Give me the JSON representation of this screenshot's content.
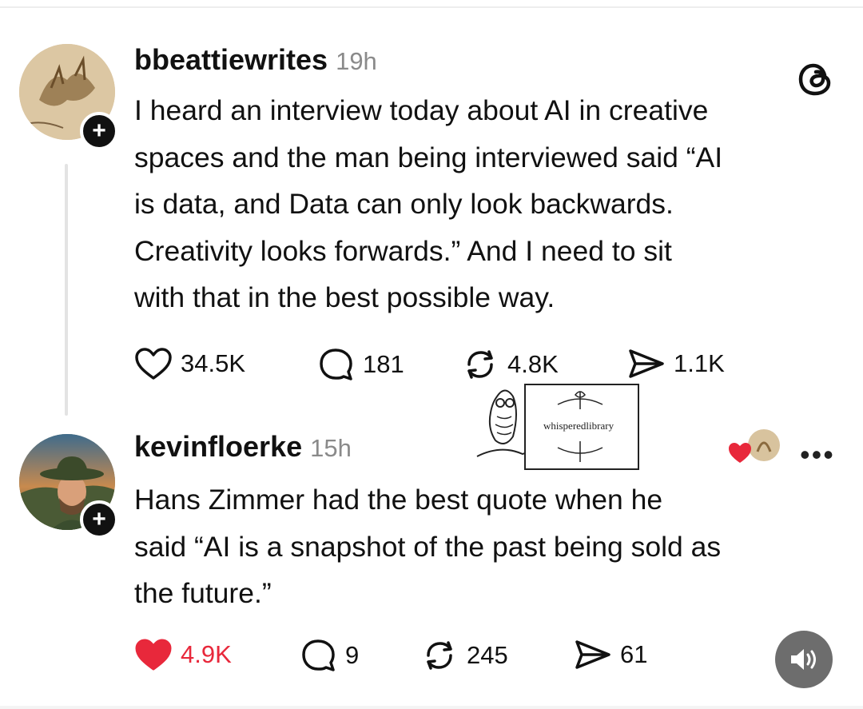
{
  "post": {
    "username": "bbeattiewrites",
    "time": "19h",
    "lines": [
      "I heard an interview today about AI in creative",
      "spaces and the man being interviewed said “AI",
      "is data, and Data can only look backwards.",
      "Creativity looks forwards.” And I need to sit",
      "with that in the best possible way."
    ],
    "likes": "34.5K",
    "replies": "181",
    "reposts": "4.8K",
    "shares": "1.1K"
  },
  "reply": {
    "username": "kevinfloerke",
    "time": "15h",
    "lines": [
      "Hans Zimmer had the best quote when he",
      "said “AI is a snapshot of the past being sold as",
      "the future.”"
    ],
    "likes": "4.9K",
    "replies": "9",
    "reposts": "245",
    "shares": "61"
  },
  "watermark": {
    "text": "whisperedlibrary"
  },
  "icons": {
    "app": "threads-icon",
    "like": "heart-icon",
    "reply": "comment-icon",
    "repost": "repost-icon",
    "share": "share-icon",
    "more": "more-icon",
    "sound": "speaker-icon"
  },
  "colors": {
    "like_active": "#e8283b",
    "muted": "#8a8a8a",
    "sound_button": "#6d6d6d"
  }
}
